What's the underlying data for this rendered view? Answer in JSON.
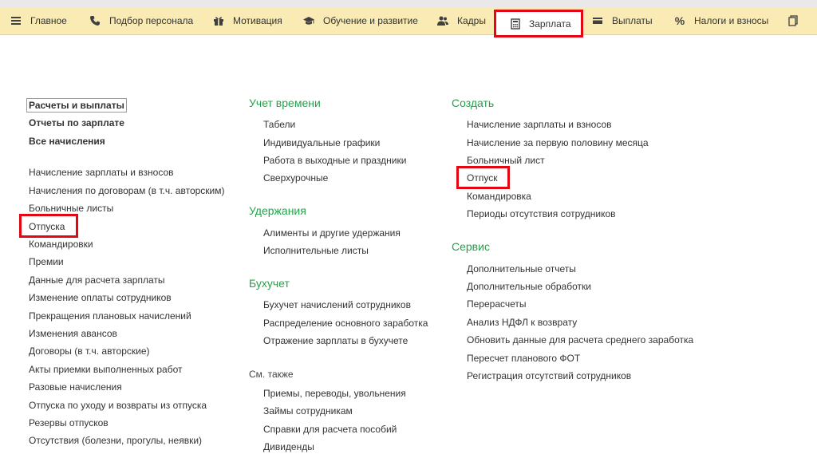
{
  "nav": {
    "items": [
      {
        "label": "Главное",
        "icon": "menu-icon"
      },
      {
        "label": "Подбор персонала",
        "icon": "phone-icon"
      },
      {
        "label": "Мотивация",
        "icon": "gift-icon"
      },
      {
        "label": "Обучение и развитие",
        "icon": "graduation-cap-icon"
      },
      {
        "label": "Кадры",
        "icon": "people-icon"
      },
      {
        "label": "Зарплата",
        "icon": "calculator-icon"
      },
      {
        "label": "Выплаты",
        "icon": "card-icon"
      },
      {
        "label": "Налоги и взносы",
        "icon": "percent-icon"
      },
      {
        "label": "",
        "icon": "documents-icon"
      }
    ],
    "active": "Зарплата"
  },
  "col1": {
    "top": [
      "Расчеты и выплаты",
      "Отчеты по зарплате",
      "Все начисления"
    ],
    "items": [
      "Начисление зарплаты и взносов",
      "Начисления по договорам (в т.ч. авторским)",
      "Больничные листы",
      "Отпуска",
      "Командировки",
      "Премии",
      "Данные для расчета зарплаты",
      "Изменение оплаты сотрудников",
      "Прекращения плановых начислений",
      "Изменения авансов",
      "Договоры (в т.ч. авторские)",
      "Акты приемки выполненных работ",
      "Разовые начисления",
      "Отпуска по уходу и возвраты из отпуска",
      "Резервы отпусков",
      "Отсутствия (болезни, прогулы, неявки)"
    ]
  },
  "col2": {
    "sections": [
      {
        "title": "Учет времени",
        "items": [
          "Табели",
          "Индивидуальные графики",
          "Работа в выходные и праздники",
          "Сверхурочные"
        ]
      },
      {
        "title": "Удержания",
        "items": [
          "Алименты и другие удержания",
          "Исполнительные листы"
        ]
      },
      {
        "title": "Бухучет",
        "items": [
          "Бухучет начислений сотрудников",
          "Распределение основного заработка",
          "Отражение зарплаты в бухучете"
        ]
      },
      {
        "title": "См. также",
        "items": [
          "Приемы, переводы, увольнения",
          "Займы сотрудникам",
          "Справки для расчета пособий",
          "Дивиденды"
        ]
      }
    ]
  },
  "col3": {
    "sections": [
      {
        "title": "Создать",
        "items": [
          "Начисление зарплаты и взносов",
          "Начисление за первую половину месяца",
          "Больничный лист",
          "Отпуск",
          "Командировка",
          "Периоды отсутствия сотрудников"
        ]
      },
      {
        "title": "Сервис",
        "items": [
          "Дополнительные отчеты",
          "Дополнительные обработки",
          "Перерасчеты",
          "Анализ НДФЛ к возврату",
          "Обновить данные для расчета среднего заработка",
          "Пересчет планового ФОТ",
          "Регистрация отсутствий сотрудников"
        ]
      }
    ]
  },
  "colors": {
    "nav_bg": "#f9ebb3",
    "section_green": "#24a24a",
    "highlight_red": "#e30613"
  }
}
